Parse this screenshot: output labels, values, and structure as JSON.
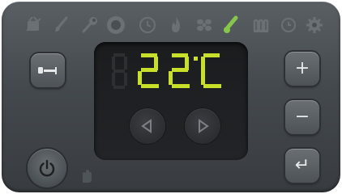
{
  "display": {
    "temperature": "22",
    "unit": "C",
    "accent": "#c8e02a"
  },
  "status_icons": [
    "child-lock-icon",
    "brush-icon",
    "wrench-icon",
    "program-ring-icon",
    "clock-icon",
    "flame-icon",
    "fan-icon",
    "thermometer-icon",
    "heating-icon",
    "timer-icon",
    "gear-icon"
  ],
  "status_active_icon": "thermometer-icon",
  "buttons": {
    "plus_label": "+",
    "minus_label": "−",
    "enter_label": "↵"
  },
  "colors": {
    "panel": "#44494e",
    "display_bg": "#1f2023",
    "icon_inactive": "#6b7075",
    "icon_active": "#86c64a",
    "segment_on": "#c8e02a",
    "segment_off": "#2d2f31"
  }
}
